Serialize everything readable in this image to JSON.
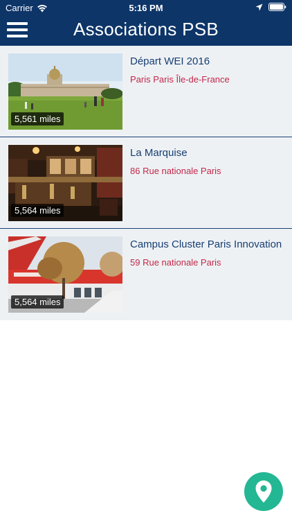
{
  "status": {
    "carrier": "Carrier",
    "time": "5:16 PM"
  },
  "header": {
    "title": "Associations PSB"
  },
  "items": [
    {
      "name": "Départ WEI 2016",
      "address": "Paris Paris Île-de-France",
      "distance": "5,561 miles"
    },
    {
      "name": "La Marquise",
      "address": "86 Rue nationale Paris",
      "distance": "5,564 miles"
    },
    {
      "name": "Campus Cluster Paris Innovation",
      "address": "59 Rue nationale Paris",
      "distance": "5,564 miles"
    }
  ],
  "colors": {
    "navbar": "#0d3568",
    "item_title": "#163e72",
    "item_address": "#c0284a",
    "list_bg": "#eef1f4",
    "fab": "#24b793"
  },
  "fab": {
    "icon": "map-pin-icon"
  }
}
